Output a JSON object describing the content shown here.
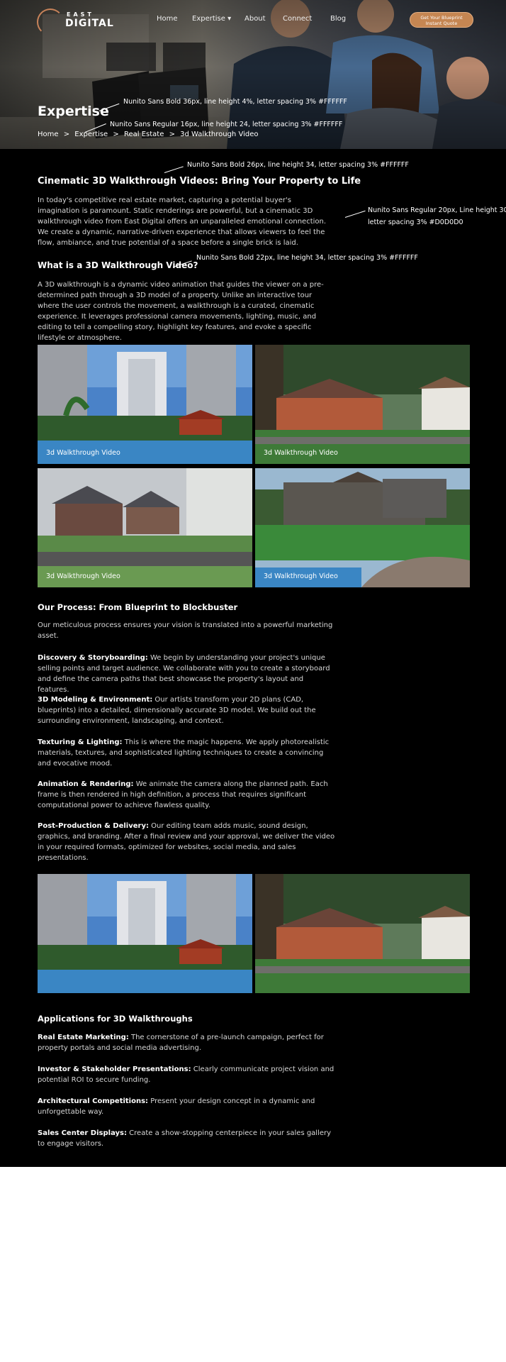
{
  "brand": {
    "line1": "EAST",
    "line2": "DIGITAL",
    "accent": "#c58652"
  },
  "nav": {
    "home": "Home",
    "expertise": "Expertise",
    "about": "About",
    "connect": "Connect",
    "blog": "Blog",
    "cta_line1": "Get Your Blueprint",
    "cta_line2": "Instant Quote"
  },
  "hero": {
    "title": "Expertise",
    "breadcrumb": [
      "Home",
      ">",
      "Expertise",
      ">",
      "Real Estate",
      ">",
      "3d Walkthrough Video"
    ]
  },
  "annotations": {
    "hero_title": "Nunito Sans Bold 36px, line height 4%, letter spacing 3% #FFFFFF",
    "breadcrumb": "Nunito Sans Regular 16px, line height 24, letter spacing 3% #FFFFFF",
    "heading": "Nunito Sans Bold 26px, line height 34, letter spacing 3% #FFFFFF",
    "body_1": "Nunito Sans Regular 20px, Line height 30,",
    "body_2": "letter spacing 3% #D0D0D0",
    "subheading": "Nunito Sans Bold 22px, line height 34, letter spacing 3% #FFFFFF"
  },
  "intro": {
    "heading": "Cinematic 3D Walkthrough Videos: Bring Your Property to Life",
    "body": "In today's competitive real estate market, capturing a potential buyer's imagination is paramount. Static renderings are powerful, but a cinematic 3D walkthrough video from East Digital offers an unparalleled emotional connection. We create a dynamic, narrative-driven experience that allows viewers to feel the flow, ambiance, and true potential of a space before a single brick is laid."
  },
  "what": {
    "heading": "What is a 3D Walkthrough Video?",
    "body": "A 3D walkthrough is a dynamic video animation that guides the viewer on a pre-determined path through a 3D model of a property. Unlike an interactive tour where the user controls the movement, a walkthrough is a curated, cinematic experience. It leverages professional camera movements, lighting, music, and editing to tell a compelling story, highlight key features, and evoke a specific lifestyle or atmosphere."
  },
  "gallery": {
    "caption": "3d Walkthrough Video"
  },
  "process": {
    "heading": "Our Process: From Blueprint to Blockbuster",
    "intro": "Our meticulous process ensures your vision is translated into a powerful marketing asset.",
    "steps": [
      {
        "title": "Discovery & Storyboarding:",
        "text": " We begin by understanding your project's unique selling points and target audience. We collaborate with you to create a storyboard and define the camera paths that best showcase the property's layout and features."
      },
      {
        "title": "3D Modeling & Environment:",
        "text": " Our artists transform your 2D plans (CAD, blueprints) into a detailed, dimensionally accurate 3D model. We build out the surrounding environment, landscaping, and context."
      },
      {
        "title": "Texturing & Lighting:",
        "text": " This is where the magic happens. We apply photorealistic materials, textures, and sophisticated lighting techniques to create a convincing and evocative mood."
      },
      {
        "title": "Animation & Rendering:",
        "text": " We animate the camera along the planned path. Each frame is then rendered in high definition, a process that requires significant computational power to achieve flawless quality."
      },
      {
        "title": "Post-Production & Delivery:",
        "text": " Our editing team adds music, sound design, graphics, and branding. After a final review and your approval, we deliver the video in your required formats, optimized for websites, social media, and sales presentations."
      }
    ]
  },
  "applications": {
    "heading": "Applications for 3D Walkthroughs",
    "items": [
      {
        "title": "Real Estate Marketing:",
        "text": " The cornerstone of a pre-launch campaign, perfect for property portals and social media advertising."
      },
      {
        "title": "Investor & Stakeholder Presentations:",
        "text": " Clearly communicate project vision and potential ROI to secure funding."
      },
      {
        "title": "Architectural Competitions:",
        "text": " Present your design concept in a dynamic and unforgettable way."
      },
      {
        "title": "Sales Center Displays:",
        "text": " Create a show-stopping centerpiece in your sales gallery to engage visitors."
      }
    ]
  }
}
